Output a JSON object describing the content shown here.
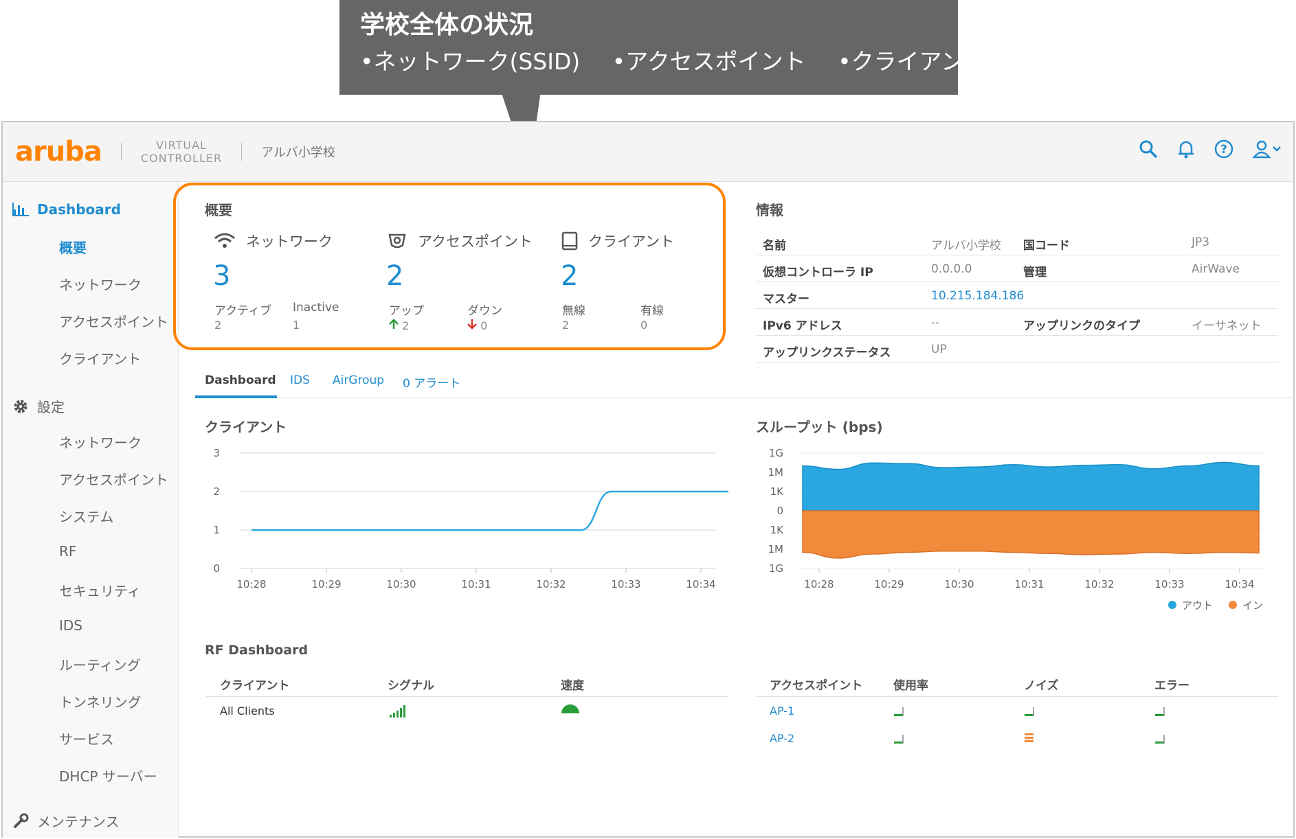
{
  "callout": {
    "title": "学校全体の状況",
    "items": [
      "•ネットワーク(SSID)",
      "•アクセスポイント",
      "•クライアント"
    ]
  },
  "header": {
    "logo": "aruba",
    "product_line1": "VIRTUAL",
    "product_line2": "CONTROLLER",
    "site": "アルバ小学校",
    "icons": [
      "search-icon",
      "bell-icon",
      "help-icon",
      "user-icon"
    ],
    "accent": "#1f8ccf",
    "brand": "#ff8300"
  },
  "sidebar": {
    "dashboard": "Dashboard",
    "dashboard_items": [
      "概要",
      "ネットワーク",
      "アクセスポイント",
      "クライアント"
    ],
    "settings": "設定",
    "settings_items": [
      "ネットワーク",
      "アクセスポイント",
      "システム",
      "RF",
      "セキュリティ",
      "IDS",
      "ルーティング",
      "トンネリング",
      "サービス",
      "DHCP サーバー"
    ],
    "maintenance": "メンテナンス"
  },
  "overview": {
    "title": "概要",
    "network": {
      "label": "ネットワーク",
      "count": "3",
      "a_label": "アクティブ",
      "a_value": "2",
      "b_label": "Inactive",
      "b_value": "1"
    },
    "ap": {
      "label": "アクセスポイント",
      "count": "2",
      "a_label": "アップ",
      "a_value": "2",
      "b_label": "ダウン",
      "b_value": "0"
    },
    "client": {
      "label": "クライアント",
      "count": "2",
      "a_label": "無線",
      "a_value": "2",
      "b_label": "有線",
      "b_value": "0"
    }
  },
  "info": {
    "title": "情報",
    "rows": [
      {
        "k1": "名前",
        "v1": "アルバ小学校",
        "k2": "国コード",
        "v2": "JP3"
      },
      {
        "k1": "仮想コントローラ IP",
        "v1": "0.0.0.0",
        "k2": "管理",
        "v2": "AirWave"
      },
      {
        "k1": "マスター",
        "v1": "10.215.184.186",
        "k2": "",
        "v2": ""
      },
      {
        "k1": "IPv6 アドレス",
        "v1": "--",
        "k2": "アップリンクのタイプ",
        "v2": "イーサネット"
      },
      {
        "k1": "アップリンクステータス",
        "v1": "UP",
        "k2": "",
        "v2": ""
      }
    ]
  },
  "tabs": [
    "Dashboard",
    "IDS",
    "AirGroup",
    "0 アラート"
  ],
  "chart_data": [
    {
      "type": "line",
      "title": "クライアント",
      "x": [
        "10:28",
        "10:29",
        "10:30",
        "10:31",
        "10:32",
        "10:33",
        "10:34"
      ],
      "ylim": [
        0,
        3
      ],
      "yticks": [
        "0",
        "1",
        "2",
        "3"
      ],
      "series": [
        {
          "points": [
            [
              0,
              1
            ],
            [
              4.4,
              1
            ],
            [
              4.8,
              2
            ],
            [
              6.4,
              2
            ]
          ]
        }
      ],
      "grid": true
    },
    {
      "type": "area",
      "title": "スループット (bps)",
      "x": [
        "10:28",
        "10:29",
        "10:30",
        "10:31",
        "10:32",
        "10:33",
        "10:34"
      ],
      "yticks": [
        "1G",
        "1M",
        "1K",
        "0",
        "1K",
        "1M",
        "1G"
      ],
      "series": [
        {
          "name": "アウト",
          "color": "#2aa7e0",
          "values": [
            0.78,
            0.72,
            0.83,
            0.82,
            0.75,
            0.76,
            0.8,
            0.76,
            0.79,
            0.8,
            0.73,
            0.78,
            0.84,
            0.78
          ]
        },
        {
          "name": "イン",
          "color": "#f28a3c",
          "values": [
            0.72,
            0.82,
            0.75,
            0.72,
            0.7,
            0.7,
            0.72,
            0.74,
            0.76,
            0.75,
            0.72,
            0.74,
            0.72,
            0.73
          ]
        }
      ],
      "legend": "bottom-right"
    }
  ],
  "rf": {
    "title": "RF Dashboard",
    "client_headers": [
      "クライアント",
      "シグナル",
      "速度"
    ],
    "client_row": "All Clients",
    "ap_headers": [
      "アクセスポイント",
      "使用率",
      "ノイズ",
      "エラー"
    ],
    "aps": [
      "AP-1",
      "AP-2"
    ]
  }
}
